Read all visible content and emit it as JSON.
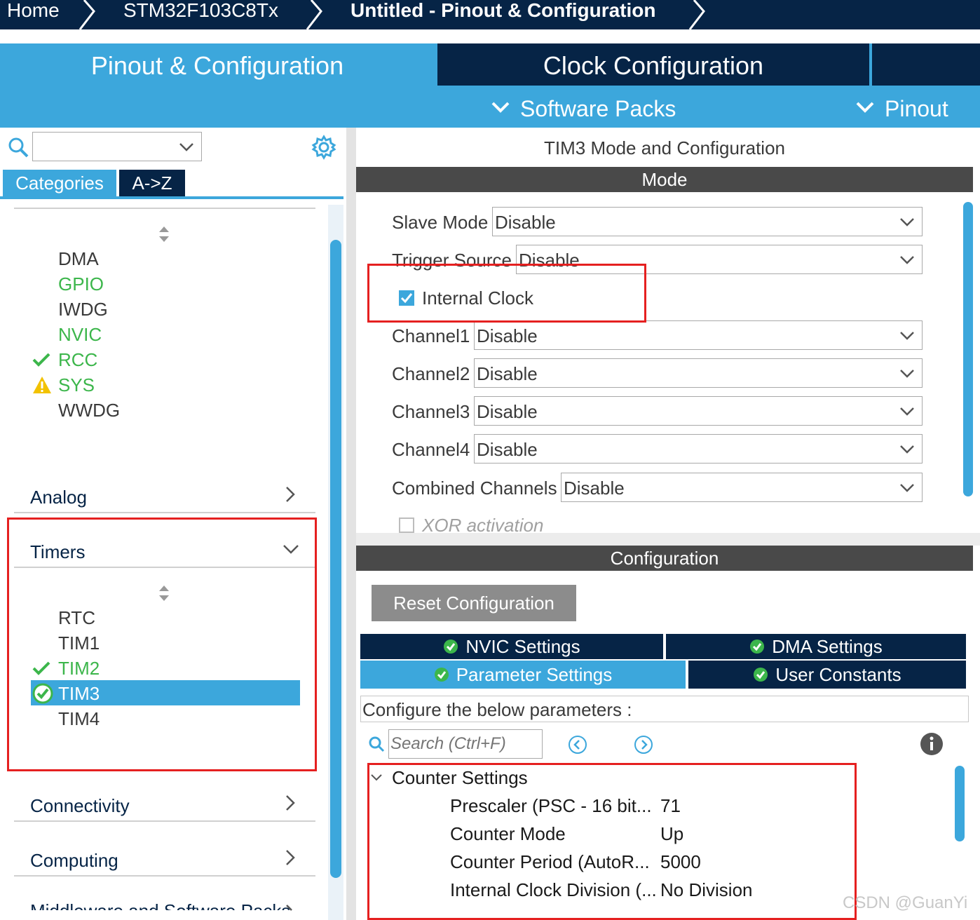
{
  "breadcrumb": {
    "home": "Home",
    "device": "STM32F103C8Tx",
    "project": "Untitled - Pinout & Configuration"
  },
  "tabs": {
    "pinout": "Pinout & Configuration",
    "clock": "Clock Configuration",
    "software_packs": "Software Packs",
    "pinout_menu": "Pinout"
  },
  "left": {
    "search_value": "",
    "categories_tab": "Categories",
    "az_tab": "A->Z",
    "system_items": [
      {
        "label": "DMA",
        "status": "none"
      },
      {
        "label": "GPIO",
        "status": "configured"
      },
      {
        "label": "IWDG",
        "status": "none"
      },
      {
        "label": "NVIC",
        "status": "configured"
      },
      {
        "label": "RCC",
        "status": "ok"
      },
      {
        "label": "SYS",
        "status": "warning"
      },
      {
        "label": "WWDG",
        "status": "none"
      }
    ],
    "analog": "Analog",
    "timers": "Timers",
    "timer_items": [
      {
        "label": "RTC",
        "status": "none"
      },
      {
        "label": "TIM1",
        "status": "none"
      },
      {
        "label": "TIM2",
        "status": "ok"
      },
      {
        "label": "TIM3",
        "status": "selected"
      },
      {
        "label": "TIM4",
        "status": "none"
      }
    ],
    "connectivity": "Connectivity",
    "computing": "Computing",
    "middleware": "Middleware and Software Packs"
  },
  "right": {
    "title": "TIM3 Mode and Configuration",
    "mode_header": "Mode",
    "slave_mode_label": "Slave Mode",
    "slave_mode_value": "Disable",
    "trigger_source_label": "Trigger Source",
    "trigger_source_value": "Disable",
    "internal_clock_label": "Internal Clock",
    "internal_clock_checked": true,
    "channel1_label": "Channel1",
    "channel1_value": "Disable",
    "channel2_label": "Channel2",
    "channel2_value": "Disable",
    "channel3_label": "Channel3",
    "channel3_value": "Disable",
    "channel4_label": "Channel4",
    "channel4_value": "Disable",
    "combined_label": "Combined Channels",
    "combined_value": "Disable",
    "xor_label": "XOR activation",
    "xor_checked": false,
    "config_header": "Configuration",
    "reset_button": "Reset Configuration",
    "nvic_tab": "NVIC Settings",
    "dma_tab": "DMA Settings",
    "param_tab": "Parameter Settings",
    "user_tab": "User Constants",
    "configure_text": "Configure the below parameters :",
    "search_placeholder": "Search (Ctrl+F)",
    "counter_group": "Counter Settings",
    "params": [
      {
        "name": "Prescaler (PSC - 16 bit...",
        "value": "71"
      },
      {
        "name": "Counter Mode",
        "value": "Up"
      },
      {
        "name": "Counter Period (AutoR...",
        "value": "5000"
      },
      {
        "name": "Internal Clock Division (...",
        "value": "No Division"
      }
    ]
  },
  "watermark": "CSDN @GuanYi",
  "colors": {
    "navy": "#062446",
    "blue": "#3ca7dc",
    "green": "#3cb64b",
    "warning": "#f2c200",
    "highlight_red": "#e52020",
    "header_gray": "#494949"
  }
}
